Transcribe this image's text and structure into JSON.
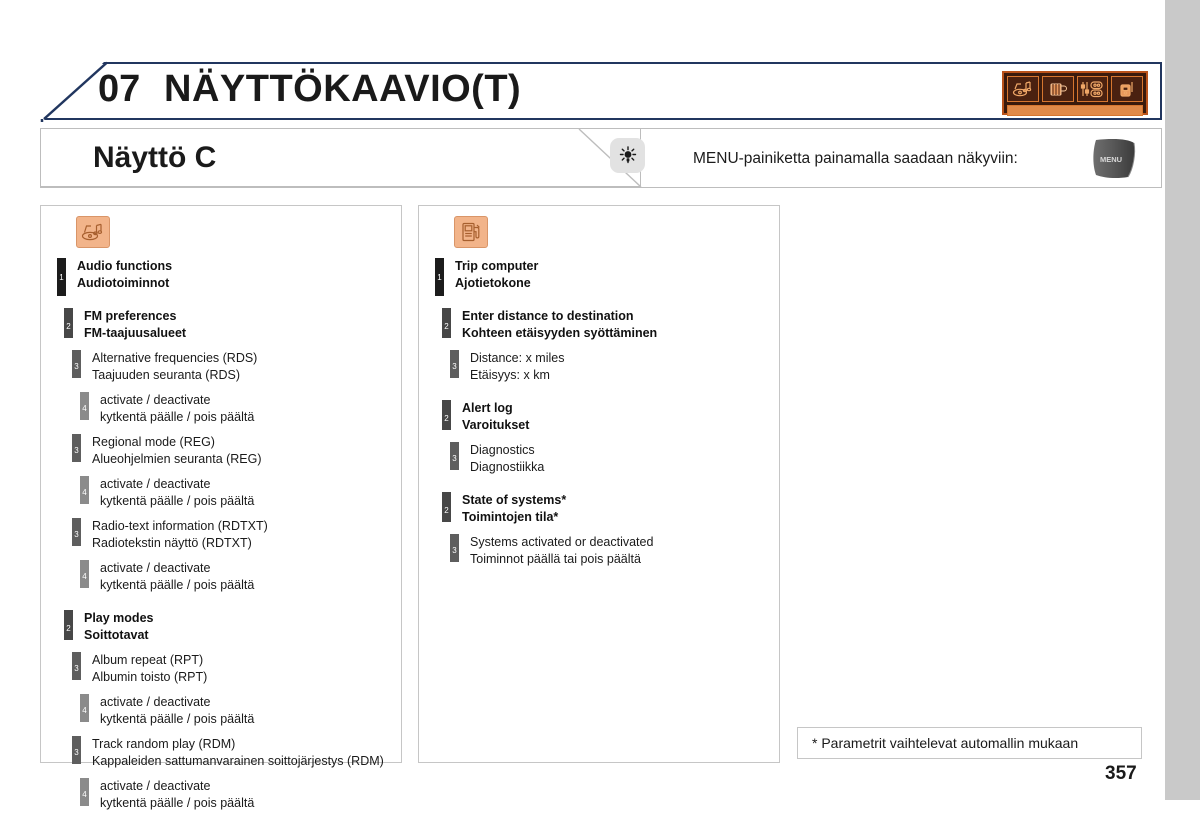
{
  "header": {
    "chapter_number": "07",
    "chapter_title": "NÄYTTÖKAAVIO(T)",
    "border_color": "#21365f",
    "display_art": {
      "name": "display-strip-artwork",
      "background": "#3a1a0c",
      "accent": "#e08a49",
      "cells": [
        "audio-icon",
        "cup-icon",
        "settings-icon",
        "phone-icon"
      ]
    }
  },
  "sub_header": {
    "title": "Näyttö C",
    "tip_icon": "lightbulb-icon",
    "tip_text": "MENU-painiketta painamalla saadaan näkyviin:",
    "menu_button_label": "MENU"
  },
  "panels": [
    {
      "id": "audio",
      "icon": "audio-media-icon",
      "nodes": [
        {
          "level": 1,
          "en": "Audio functions",
          "fi": "Audiotoiminnot"
        },
        {
          "level": 2,
          "en": "FM preferences",
          "fi": "FM-taajuusalueet"
        },
        {
          "level": 3,
          "en": "Alternative frequencies (RDS)",
          "fi": "Taajuuden seuranta (RDS)"
        },
        {
          "level": 4,
          "en": "activate / deactivate",
          "fi": "kytkentä päälle / pois päältä"
        },
        {
          "level": 3,
          "en": "Regional mode (REG)",
          "fi": "Alueohjelmien seuranta (REG)"
        },
        {
          "level": 4,
          "en": "activate / deactivate",
          "fi": "kytkentä päälle / pois päältä"
        },
        {
          "level": 3,
          "en": "Radio-text information (RDTXT)",
          "fi": "Radiotekstin näyttö (RDTXT)"
        },
        {
          "level": 4,
          "en": "activate / deactivate",
          "fi": "kytkentä päälle / pois päältä"
        },
        {
          "level": 2,
          "en": "Play modes",
          "fi": "Soittotavat"
        },
        {
          "level": 3,
          "en": "Album repeat (RPT)",
          "fi": "Albumin toisto (RPT)"
        },
        {
          "level": 4,
          "en": "activate / deactivate",
          "fi": "kytkentä päälle / pois päältä"
        },
        {
          "level": 3,
          "en": "Track random play (RDM)",
          "fi": "Kappaleiden sattumanvarainen soittojärjestys (RDM)"
        },
        {
          "level": 4,
          "en": "activate / deactivate",
          "fi": "kytkentä päälle / pois päältä"
        }
      ]
    },
    {
      "id": "trip",
      "icon": "fuel-pump-icon",
      "nodes": [
        {
          "level": 1,
          "en": "Trip computer",
          "fi": "Ajotietokone"
        },
        {
          "level": 2,
          "en": "Enter distance to destination",
          "fi": "Kohteen etäisyyden syöttäminen"
        },
        {
          "level": 3,
          "en": "Distance: x miles",
          "fi": "Etäisyys: x km"
        },
        {
          "level": 2,
          "en": "Alert log",
          "fi": "Varoitukset"
        },
        {
          "level": 3,
          "en": "Diagnostics",
          "fi": "Diagnostiikka"
        },
        {
          "level": 2,
          "en": "State of systems*",
          "fi": "Toimintojen tila*"
        },
        {
          "level": 3,
          "en": "Systems activated or deactivated",
          "fi": "Toiminnot päällä tai pois päältä"
        }
      ]
    }
  ],
  "footnote": "* Parametrit vaihtelevat automallin mukaan",
  "page_number": "357",
  "level_colors": {
    "1": "#1c1c1c",
    "2": "#474747",
    "3": "#5e5e5e",
    "4": "#8b8b8b"
  }
}
